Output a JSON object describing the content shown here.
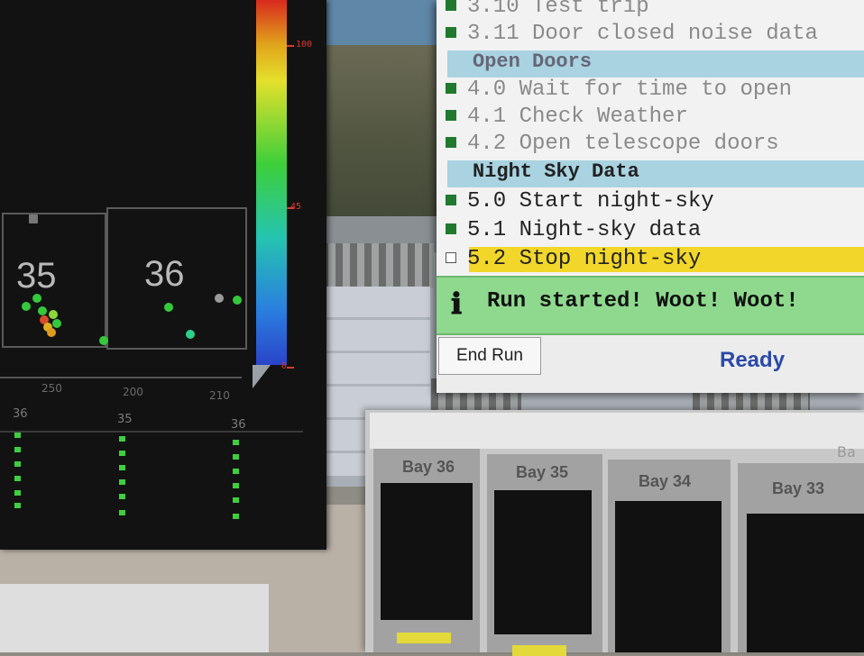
{
  "colorbar": {
    "max_label": "100",
    "mid_label": "45",
    "min_label": "0"
  },
  "bay_map": {
    "bays": [
      "35",
      "36"
    ],
    "axis_labels": [
      "250",
      "200",
      "210"
    ]
  },
  "columns": {
    "heads": [
      "36",
      "35",
      "36"
    ]
  },
  "checklist": {
    "items": [
      {
        "num": "3.10",
        "text": "Test trip",
        "state": "done"
      },
      {
        "num": "3.11",
        "text": "Door closed noise data",
        "state": "done"
      },
      {
        "section": "Open Doors"
      },
      {
        "num": "4.0",
        "text": "Wait for time to open",
        "state": "done"
      },
      {
        "num": "4.1",
        "text": "Check Weather",
        "state": "done"
      },
      {
        "num": "4.2",
        "text": "Open telescope doors",
        "state": "done"
      },
      {
        "section": "Night Sky Data"
      },
      {
        "num": "5.0",
        "text": "Start night-sky",
        "state": "done"
      },
      {
        "num": "5.1",
        "text": "Night-sky data",
        "state": "done"
      },
      {
        "num": "5.2",
        "text": "Stop night-sky",
        "state": "current"
      }
    ],
    "message": "Run started! Woot! Woot!",
    "message_icon": "info-icon",
    "end_run_label": "End Run",
    "status": "Ready"
  },
  "bays_window": {
    "bays": [
      "Bay 36",
      "Bay 35",
      "Bay 34",
      "Bay 33"
    ],
    "tab_label": "Ba"
  },
  "colors": {
    "done": "#1f7a2e",
    "highlight": "#f2d72a",
    "message_bg": "#8ed98e",
    "section_bg": "#a9d3e1",
    "ready": "#2a4aa8"
  }
}
